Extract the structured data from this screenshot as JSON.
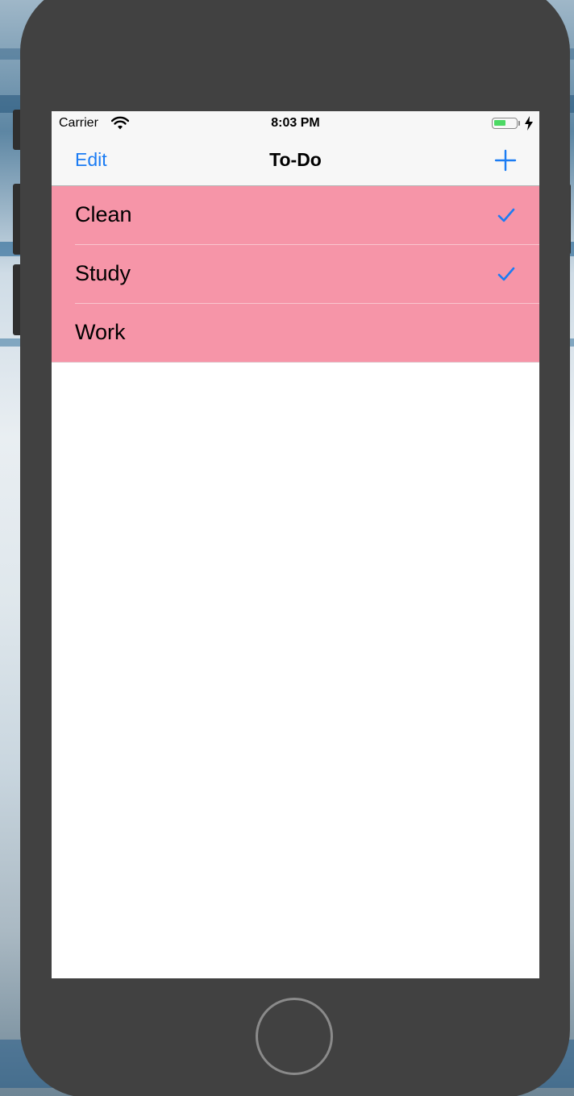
{
  "status_bar": {
    "carrier": "Carrier",
    "time": "8:03 PM",
    "battery_level_percent": 55,
    "icons": [
      "wifi-icon",
      "battery-icon",
      "charging-bolt-icon"
    ]
  },
  "nav": {
    "edit_label": "Edit",
    "title": "To-Do",
    "add_icon": "plus-icon"
  },
  "items": [
    {
      "label": "Clean",
      "checked": true
    },
    {
      "label": "Study",
      "checked": true
    },
    {
      "label": "Work",
      "checked": false
    }
  ],
  "colors": {
    "row_background": "#f695a8",
    "accent": "#1b7cf3",
    "device_body": "#414141",
    "battery_fill": "#4cd964"
  }
}
